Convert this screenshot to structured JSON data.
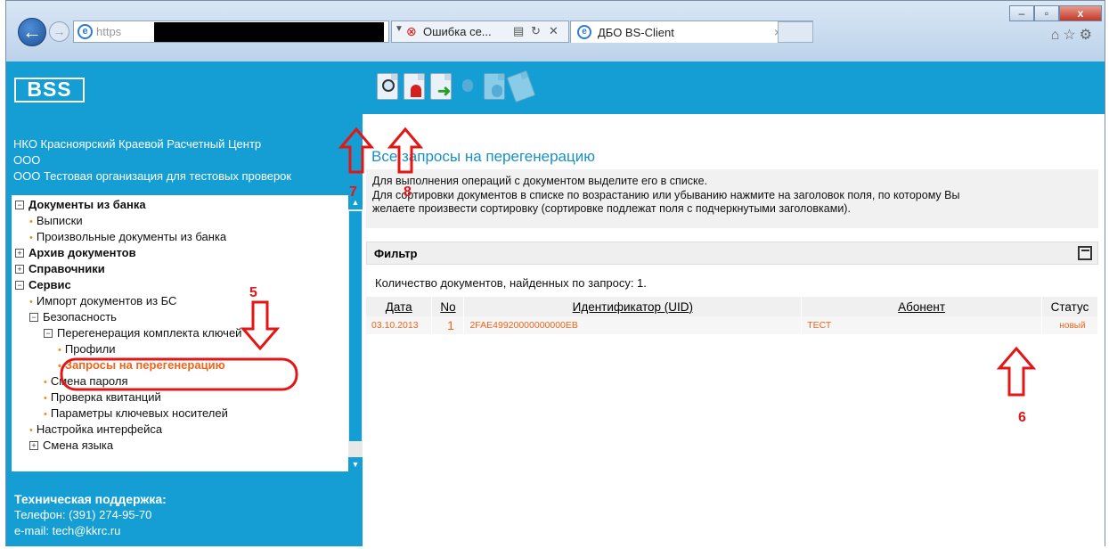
{
  "browser": {
    "address_protocol": "https",
    "error_tab_label": "Ошибка се...",
    "tab_title": "ДБО BS-Client",
    "tab_close": "×",
    "window_buttons": {
      "minimize": "–",
      "maximize": "▫",
      "close": "x"
    },
    "tools_icons": [
      "home-icon",
      "star-icon",
      "gear-icon"
    ]
  },
  "toolbar": {
    "logo": "BSS",
    "icons": [
      "view-doc-icon",
      "revoke-cert-icon",
      "export-doc-icon",
      "certificate-icon",
      "sign-doc-icon",
      "edit-doc-icon"
    ]
  },
  "sidebar": {
    "org_lines": [
      "НКО Красноярский Краевой Расчетный Центр",
      "ООО",
      "ООО Тестовая организация для тестовых проверок"
    ],
    "tree": [
      {
        "label": "Документы из банка",
        "level": 0,
        "bold": true,
        "toggle": "−"
      },
      {
        "label": "Выписки",
        "level": 1,
        "bullet": true
      },
      {
        "label": "Произвольные документы из банка",
        "level": 1,
        "bullet": true
      },
      {
        "label": "Архив документов",
        "level": 0,
        "bold": true,
        "toggle": "+"
      },
      {
        "label": "Справочники",
        "level": 0,
        "bold": true,
        "toggle": "+"
      },
      {
        "label": "Сервис",
        "level": 0,
        "bold": true,
        "toggle": "−"
      },
      {
        "label": "Импорт документов из БС",
        "level": 1,
        "bullet": true
      },
      {
        "label": "Безопасность",
        "level": 1,
        "toggle": "−"
      },
      {
        "label": "Перегенерация комплекта ключей",
        "level": 2,
        "toggle": "−"
      },
      {
        "label": "Профили",
        "level": 3,
        "bullet": true
      },
      {
        "label": "Запросы на перегенерацию",
        "level": 3,
        "bullet": true,
        "selected": true
      },
      {
        "label": "Смена пароля",
        "level": 2,
        "bullet": true
      },
      {
        "label": "Проверка квитанций",
        "level": 2,
        "bullet": true
      },
      {
        "label": "Параметры ключевых носителей",
        "level": 2,
        "bullet": true
      },
      {
        "label": "Настройка интерфейса",
        "level": 1,
        "bullet": true
      },
      {
        "label": "Смена языка",
        "level": 1,
        "toggle": "+"
      }
    ],
    "support": {
      "title": "Техническая поддержка:",
      "phone": "Телефон: (391) 274-95-70",
      "email": "e-mail: tech@kkrc.ru"
    }
  },
  "main": {
    "heading": "Все запросы на перегенерацию",
    "info_line1": "Для выполнения операций с документом выделите его в списке.",
    "info_line2": "Для сортировки документов в списке по возрастанию или убыванию нажмите на заголовок поля, по которому Вы",
    "info_line3": "желаете произвести сортировку (сортировке подлежат поля с подчеркнутыми заголовками).",
    "filter_label": "Фильтр",
    "count_text": "Количество  документов, найденных по запросу:  1.",
    "columns": [
      "Дата",
      "No",
      "Идентификатор (UID)",
      "Абонент",
      "Статус"
    ],
    "rows": [
      {
        "date": "03.10.2013",
        "no": "1",
        "uid": "2FAE49920000000000EB",
        "subscriber": "ТЕСТ",
        "status": "новый"
      }
    ]
  },
  "annotations": {
    "marks": [
      "5",
      "6",
      "7",
      "8"
    ],
    "color": "#e51515"
  }
}
